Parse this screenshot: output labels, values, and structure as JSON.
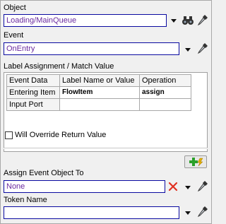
{
  "object": {
    "label": "Object",
    "value": "Loading/MainQueue"
  },
  "event": {
    "label": "Event",
    "value": "OnEntry"
  },
  "label_assignment": {
    "title": "Label Assignment / Match Value",
    "headers": [
      "Event Data",
      "Label Name or Value",
      "Operation"
    ],
    "rows": [
      {
        "event_data": "Entering Item",
        "label": "FlowItem",
        "operation": "assign"
      },
      {
        "event_data": "Input Port",
        "label": "",
        "operation": ""
      }
    ]
  },
  "override": {
    "label": "Will Override Return Value",
    "checked": false
  },
  "assign_event_object": {
    "label": "Assign Event Object To",
    "value": "None"
  },
  "token_name": {
    "label": "Token Name",
    "value": ""
  },
  "icons": {
    "sample": "binoculars-icon",
    "eyedropper": "eyedropper-icon",
    "clear": "red-x-icon",
    "add": "green-plus-lightning-icon"
  },
  "colors": {
    "field_border": "#0a0aa0",
    "field_text": "#6a2aa0",
    "clear_x": "#e03020",
    "add_plus": "#2aa02a"
  }
}
